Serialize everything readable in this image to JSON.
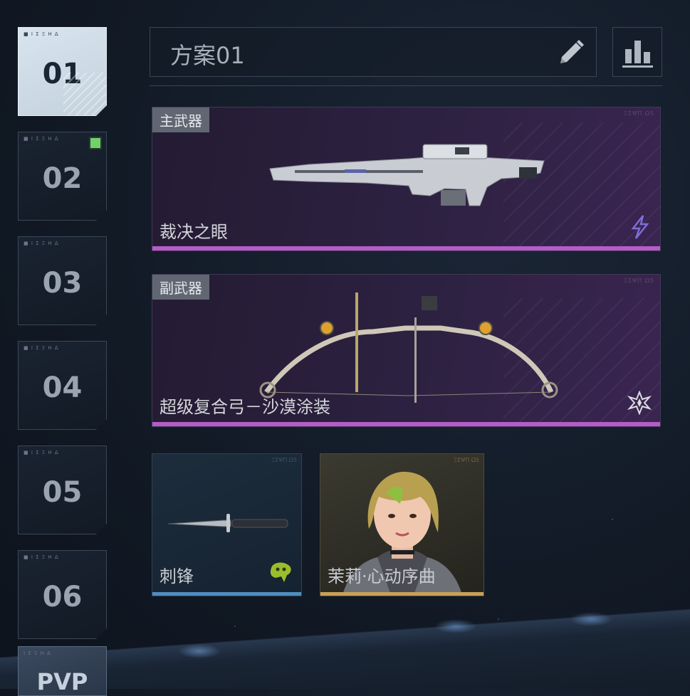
{
  "slots": [
    {
      "num": "01",
      "tag": "■ I Σ Ξ H Δ",
      "active": true
    },
    {
      "num": "02",
      "tag": "■ I Σ Ξ H Δ",
      "badge": true
    },
    {
      "num": "03",
      "tag": "■ I Σ Ξ H Δ"
    },
    {
      "num": "04",
      "tag": "■ I Σ Ξ H Δ"
    },
    {
      "num": "05",
      "tag": "■ I Σ Ξ H Δ"
    },
    {
      "num": "06",
      "tag": "■ I Σ Ξ H Δ"
    },
    {
      "num": "PVP",
      "tag": "I Σ Ξ H Δ"
    }
  ],
  "header": {
    "loadout_name": "方案01",
    "edit_icon": "pencil-icon",
    "stats_icon": "bar-chart-icon"
  },
  "primary": {
    "category": "主武器",
    "name": "裁决之眼",
    "icon": "lightning-icon",
    "stripe_color": "#b65cc8"
  },
  "secondary": {
    "category": "副武器",
    "name": "超级复合弓－沙漠涂装",
    "icon": "star-burst-icon",
    "stripe_color": "#b65cc8"
  },
  "melee": {
    "name": "刺锋",
    "icon": "green-splat-icon",
    "stripe_color": "#4f8dbf"
  },
  "character": {
    "name": "茉莉·心动序曲",
    "stripe_color": "#c8a058"
  }
}
